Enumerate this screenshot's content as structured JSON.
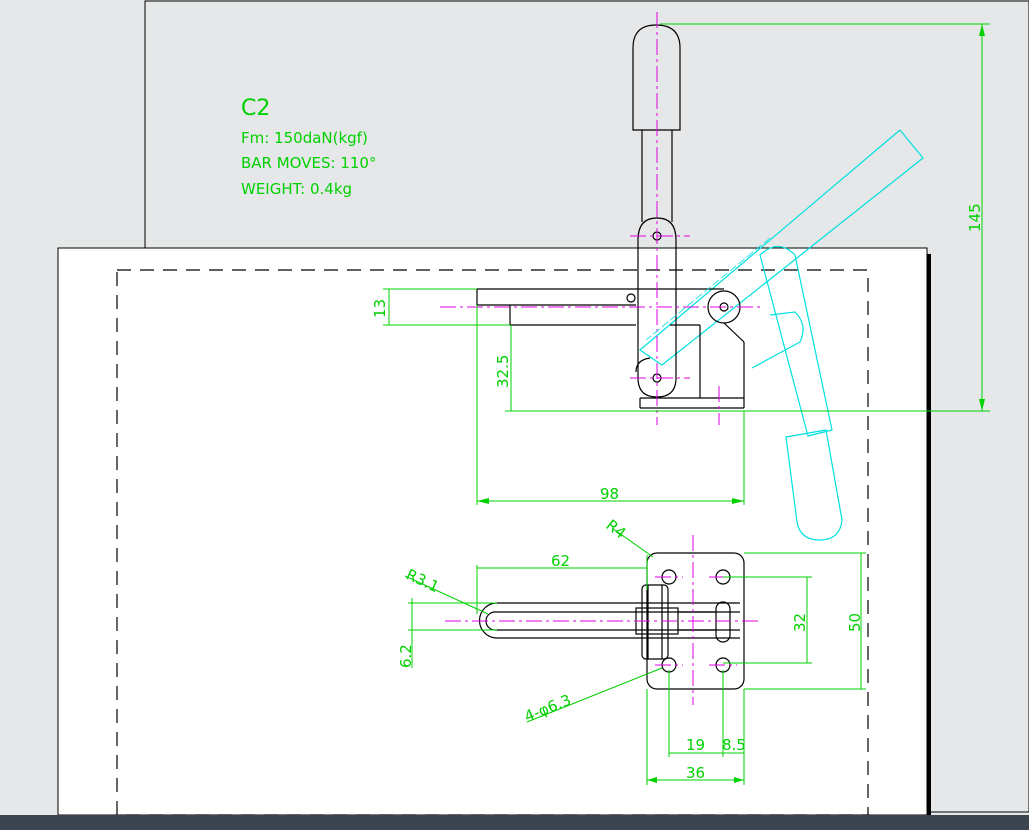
{
  "spec": {
    "model": "C2",
    "force": "Fm: 150daN(kgf)",
    "bar_moves": "BAR MOVES: 110°",
    "weight": "WEIGHT: 0.4kg"
  },
  "dimensions": {
    "height_145": "145",
    "bar_13": "13",
    "height_32_5": "32.5",
    "length_98": "98",
    "radius_r4": "R4",
    "radius_r3_1": "R3.1",
    "length_62": "62",
    "width_6_2": "6.2",
    "spacing_32": "32",
    "base_50": "50",
    "holes": "4-φ6.3",
    "spacing_19": "19",
    "spacing_8_5": "8.5",
    "base_36": "36"
  },
  "colors": {
    "background": "#e6e7e8",
    "sheet": "#ffffff",
    "outline": "#000000",
    "dimension": "#00d100",
    "centerline": "#e000e0",
    "alt_position": "#00e0e0",
    "status_bar": "#3b4550"
  }
}
